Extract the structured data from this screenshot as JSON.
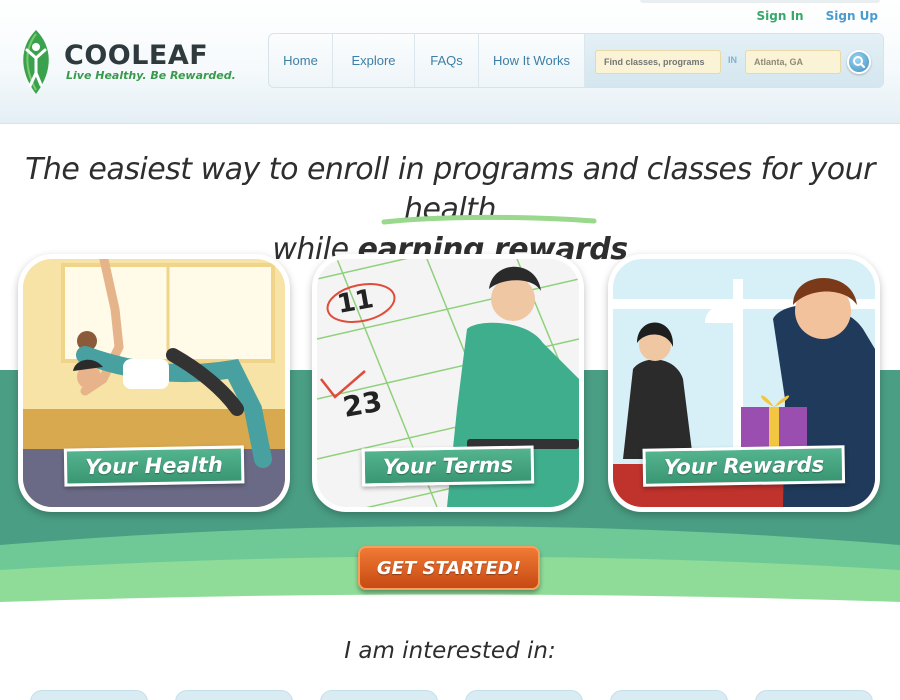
{
  "top_links": {
    "signin": "Sign In",
    "signup": "Sign Up"
  },
  "logo": {
    "name": "COOLEAF",
    "tagline": "Live Healthy. Be Rewarded."
  },
  "nav": {
    "items": [
      "Home",
      "Explore",
      "FAQs",
      "How It Works"
    ],
    "search_placeholder": "Find classes, programs",
    "in_label": "IN",
    "location_value": "Atlanta, GA"
  },
  "hero": {
    "headline_line1": "The easiest way to enroll in programs and classes for your health",
    "headline_line2_prefix": "while ",
    "headline_line2_strong": "earning rewards"
  },
  "cards": [
    {
      "label": "Your Health"
    },
    {
      "label": "Your Terms"
    },
    {
      "label": "Your Rewards"
    }
  ],
  "cta": {
    "label": "GET STARTED!"
  },
  "interest": {
    "heading": "I am interested in:"
  },
  "colors": {
    "brand_green": "#3a9a4c",
    "teal_band": "#4a9e84",
    "light_green_band": "#8fdc98",
    "cta_orange": "#e0611f",
    "link_blue": "#3d7fa6"
  }
}
